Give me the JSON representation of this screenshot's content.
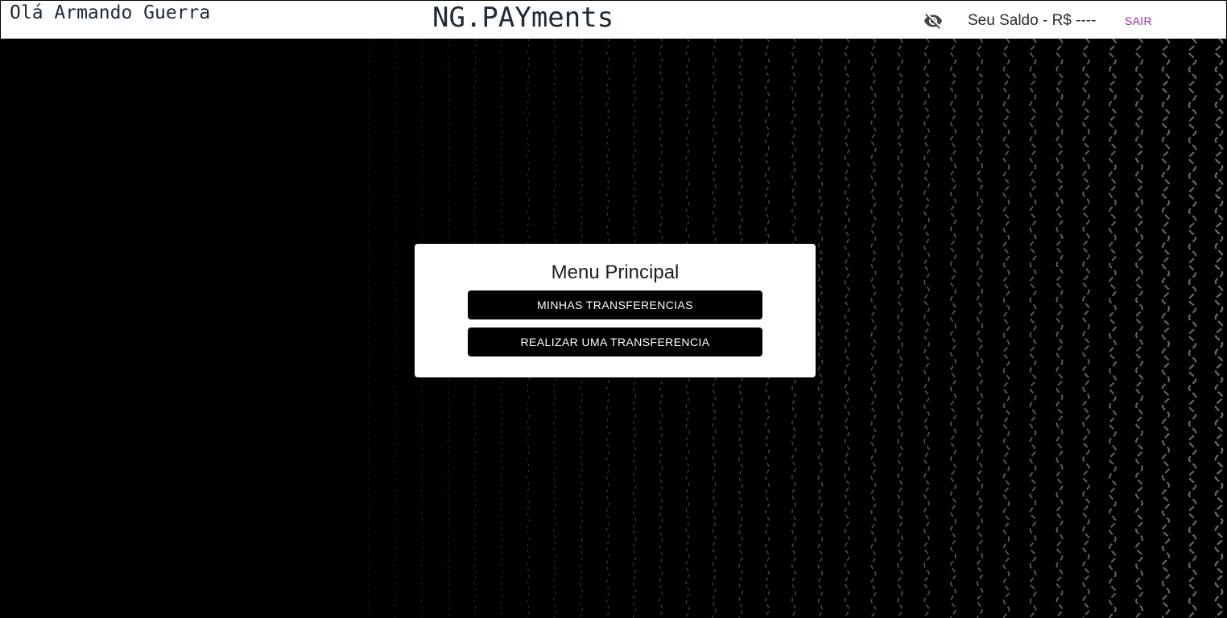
{
  "header": {
    "greeting": "Olá Armando Guerra",
    "brand": "NG.PAYments",
    "visibility_icon": "eye-off-icon",
    "balance": "Seu Saldo - R$ ----",
    "logout_label": "SAIR"
  },
  "menu": {
    "title": "Menu Principal",
    "buttons": [
      "MINHAS TRANSFERENCIAS",
      "REALIZAR UMA TRANSFERENCIA"
    ]
  },
  "colors": {
    "background": "#000000",
    "header_bg": "#ffffff",
    "logout_accent": "#9c27b0",
    "wave_stroke": "#6b6b6b"
  }
}
